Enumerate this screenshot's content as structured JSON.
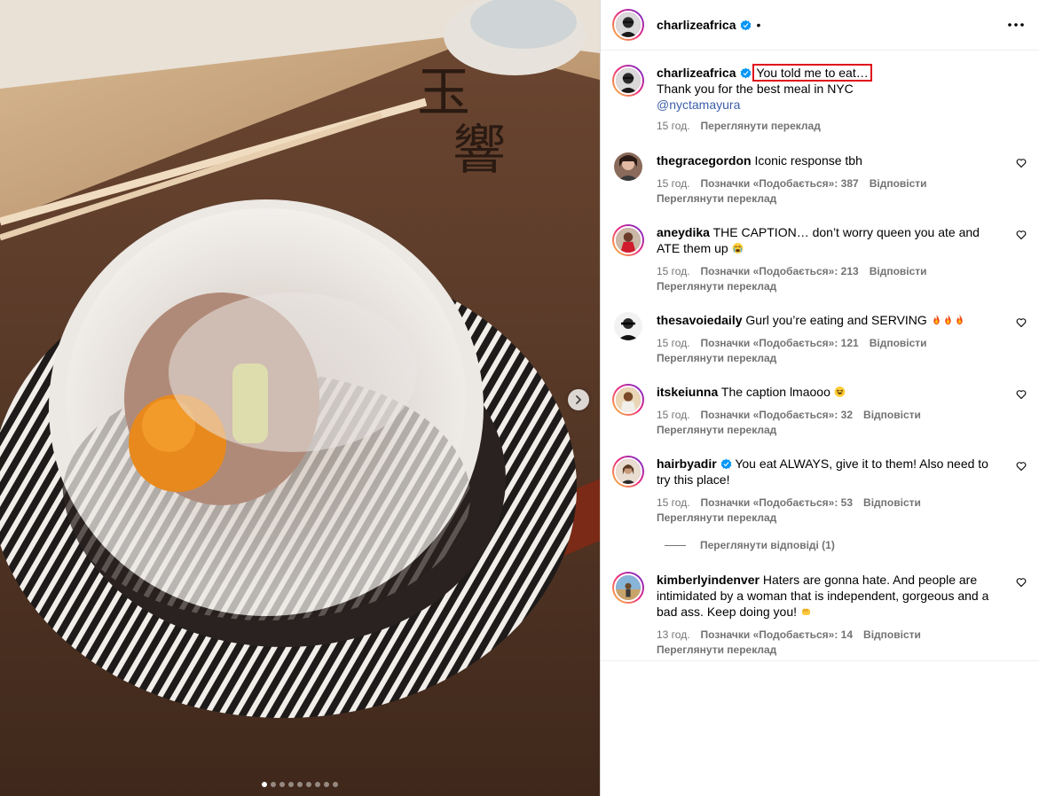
{
  "post": {
    "author": "charlizeafrica",
    "header_separator": "•",
    "caption": {
      "highlighted": "You told me to eat…",
      "line2": "Thank you for the best meal in NYC",
      "mention": "@nyctamayura",
      "time": "15 год.",
      "translate": "Переглянути переклад"
    },
    "carousel": {
      "count": 9,
      "active_index": 0
    }
  },
  "comments": [
    {
      "username": "thegracegordon",
      "verified": false,
      "text": "Iconic response tbh",
      "time": "15 год.",
      "likes": "Позначки «Подобається»: 387",
      "reply": "Відповісти",
      "translate": "Переглянути переклад"
    },
    {
      "username": "aneydika",
      "verified": false,
      "text": "THE CAPTION… don’t worry queen you ate and ATE them up",
      "emoji": "crying-face",
      "time": "15 год.",
      "likes": "Позначки «Подобається»: 213",
      "reply": "Відповісти",
      "translate": "Переглянути переклад"
    },
    {
      "username": "thesavoiedaily",
      "verified": false,
      "text": "Gurl you’re eating and SERVING",
      "emoji": "fire-x3",
      "time": "15 год.",
      "likes": "Позначки «Подобається»: 121",
      "reply": "Відповісти",
      "translate": "Переглянути переклад"
    },
    {
      "username": "itskeiunna",
      "verified": false,
      "text": "The caption lmaooo",
      "emoji": "laughing-face",
      "time": "15 год.",
      "likes": "Позначки «Подобається»: 32",
      "reply": "Відповісти",
      "translate": "Переглянути переклад"
    },
    {
      "username": "hairbyadir",
      "verified": true,
      "text": "You eat ALWAYS, give it to them! Also need to try this place!",
      "time": "15 год.",
      "likes": "Позначки «Подобається»: 53",
      "reply": "Відповісти",
      "translate": "Переглянути переклад",
      "view_replies": "Переглянути відповіді (1)"
    },
    {
      "username": "kimberlyindenver",
      "verified": false,
      "text": "Haters are gonna hate. And people are intimidated by a woman that is independent, gorgeous and a bad ass. Keep doing you!",
      "emoji": "fist",
      "time": "13 год.",
      "likes": "Позначки «Подобається»: 14",
      "reply": "Відповісти",
      "translate": "Переглянути переклад"
    }
  ],
  "colors": {
    "link": "#3d5ea8",
    "verified": "#0095f6",
    "highlight_box": "#e0101b",
    "meta": "#737373"
  }
}
